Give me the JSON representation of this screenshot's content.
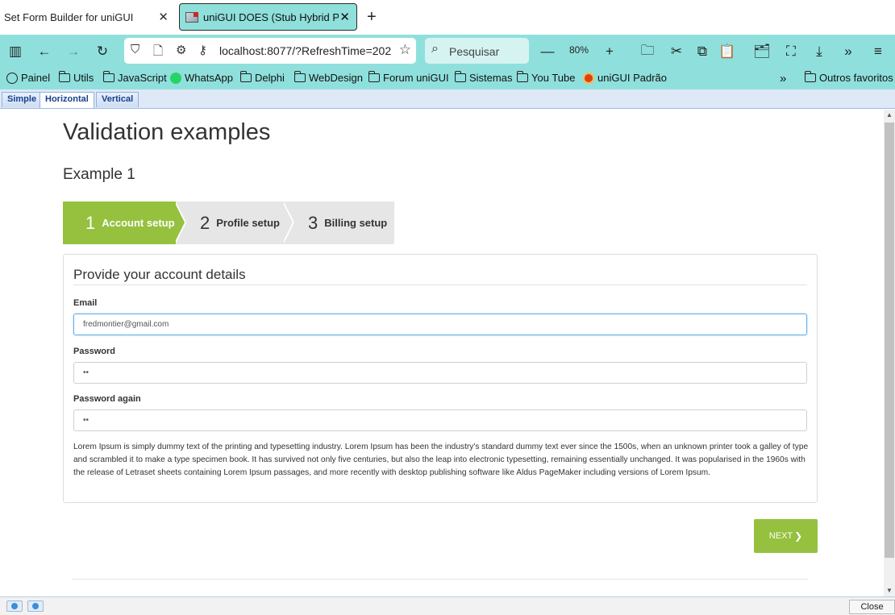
{
  "browser": {
    "tabs": [
      {
        "title": "Set Form Builder for uniGUI",
        "active": false
      },
      {
        "title": "uniGUI DOES (Stub Hybrid Project)",
        "active": true
      }
    ],
    "new_tab": "+",
    "url_prefix": "localhost:8077/?RefreshTime=202",
    "search_placeholder": "Pesquisar",
    "zoom": "80%",
    "accent": "#8fe0dc"
  },
  "bookmarks": [
    {
      "label": "Painel",
      "icon": "globe-icon"
    },
    {
      "label": "Utils",
      "icon": "folder-icon"
    },
    {
      "label": "JavaScript",
      "icon": "folder-icon"
    },
    {
      "label": "WhatsApp",
      "icon": "whatsapp-icon"
    },
    {
      "label": "Delphi",
      "icon": "folder-icon"
    },
    {
      "label": "WebDesign",
      "icon": "folder-icon"
    },
    {
      "label": "Forum uniGUI",
      "icon": "folder-icon"
    },
    {
      "label": "Sistemas",
      "icon": "folder-icon"
    },
    {
      "label": "You Tube",
      "icon": "folder-icon"
    },
    {
      "label": "uniGUI Padrão",
      "icon": "unigui-icon"
    },
    {
      "label": "Outros favoritos",
      "icon": "folder-icon"
    }
  ],
  "app_tabs": [
    {
      "label": "Simple",
      "active": false
    },
    {
      "label": "Horizontal",
      "active": true
    },
    {
      "label": "Vertical",
      "active": false
    }
  ],
  "page": {
    "title": "Validation examples",
    "example_title": "Example 1",
    "wizard_steps": [
      {
        "number": "1",
        "label": "Account setup",
        "active": true
      },
      {
        "number": "2",
        "label": "Profile setup",
        "active": false
      },
      {
        "number": "3",
        "label": "Billing setup",
        "active": false
      }
    ],
    "panel_title": "Provide your account details",
    "fields": {
      "email_label": "Email",
      "email_value": "fredmontier@gmail.com",
      "password_label": "Password",
      "password_value": "••",
      "password_again_label": "Password again",
      "password_again_value": "••"
    },
    "lorem": "Lorem Ipsum is simply dummy text of the printing and typesetting industry. Lorem Ipsum has been the industry's standard dummy text ever since the 1500s, when an unknown printer took a galley of type and scrambled it to make a type specimen book. It has survived not only five centuries, but also the leap into electronic typesetting, remaining essentially unchanged. It was popularised in the 1960s with the release of Letraset sheets containing Lorem Ipsum passages, and more recently with desktop publishing software like Aldus PageMaker including versions of Lorem Ipsum.",
    "next_label": "NEXT",
    "next_chevron": "❯",
    "accent": "#95c13e"
  },
  "statusbar": {
    "close_label": "Close"
  }
}
